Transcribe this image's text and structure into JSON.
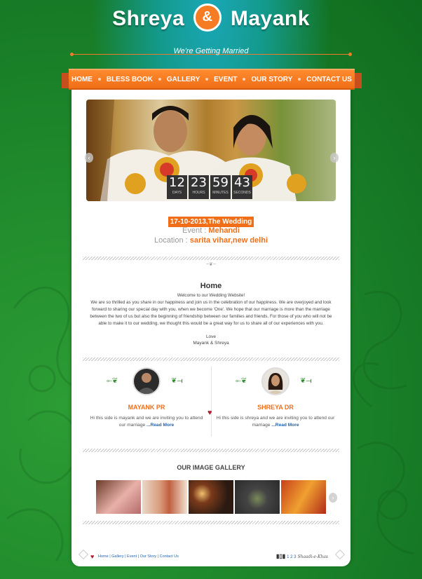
{
  "header": {
    "name_left": "Shreya",
    "amp": "&",
    "name_right": "Mayank",
    "tagline": "We're Getting Married"
  },
  "nav": {
    "items": [
      "HOME",
      "BLESS BOOK",
      "GALLERY",
      "EVENT",
      "OUR STORY",
      "CONTACT US"
    ]
  },
  "countdown": [
    {
      "value": "12",
      "label": "DAYS"
    },
    {
      "value": "23",
      "label": "HOURS"
    },
    {
      "value": "59",
      "label": "MINUTES"
    },
    {
      "value": "43",
      "label": "SECONDS"
    }
  ],
  "event": {
    "date": "17-10-2013,The Wedding Date",
    "event_key": "Event : ",
    "event_val": "Mehandi",
    "loc_key": "Location : ",
    "loc_val": "sarita vihar,new delhi"
  },
  "home": {
    "heading": "Home",
    "welcome": "Welcome to our Wedding Website!",
    "body": "We are so thrilled as you share in our happiness and join us in the celebration of our happiness. We are overjoyed and look forward to sharing our special day with you. when we become 'One'. We hope that our marriage is more than the marriage between the two of us but also the beginning of friendship between our families and friends. For those of you who will not be able to make it to our wedding, we thought this would be a great way for us to share all of our experiences with you.",
    "love": "Love",
    "signature": "Mayank & Shreya"
  },
  "profiles": [
    {
      "name": "MAYANK PR",
      "desc": "Hi this side is mayank and we are inviting you to attend our marriage ",
      "more": "...Read More"
    },
    {
      "name": "SHREYA DR",
      "desc": "Hi this side is shreya and we are inviting you to attend our marriage ",
      "more": "...Read More"
    }
  ],
  "gallery": {
    "heading": "OUR IMAGE GALLERY"
  },
  "footer": {
    "links": "Home | Gallery | Event | Our Story | Contact Us",
    "pages": "1 2 3",
    "brand": "Shaadi-e-Khas"
  },
  "colors": {
    "accent": "#f06e17",
    "green": "#1f8a2c",
    "link": "#1f64b4"
  }
}
